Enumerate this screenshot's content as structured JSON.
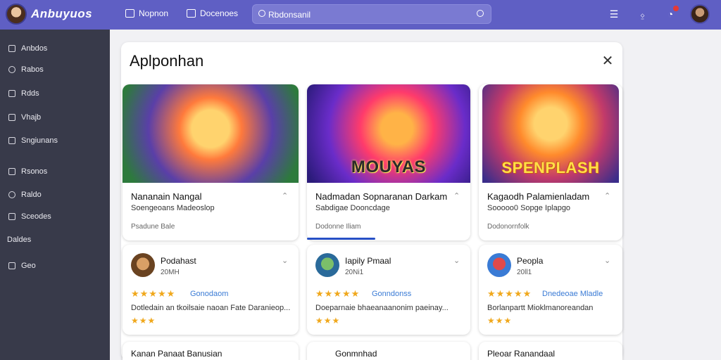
{
  "app": {
    "title": "Anbuyuos",
    "search_placeholder": "Rbdonsanil"
  },
  "topnav": [
    {
      "label": "Nopnon",
      "icon": "image-icon"
    },
    {
      "label": "Docenoes",
      "icon": "grid-icon"
    }
  ],
  "header_icons": [
    "checklist-icon",
    "bell-icon",
    "clock-icon",
    "user-avatar"
  ],
  "sidebar": {
    "items": [
      {
        "label": "Anbdos",
        "icon": "home-icon"
      },
      {
        "label": "Rabos",
        "icon": "circle-icon"
      },
      {
        "label": "Rdds",
        "icon": "bell-icon"
      },
      {
        "label": "Vhajb",
        "icon": "triangle-icon"
      },
      {
        "label": "Sngiunans",
        "icon": "document-icon"
      },
      {
        "label": "Rsonos",
        "icon": "pin-icon"
      },
      {
        "label": "Raldo",
        "icon": "search-icon"
      },
      {
        "label": "Sceodes",
        "icon": "list-icon"
      },
      {
        "label": "Daldes",
        "icon": ""
      },
      {
        "label": "Geo",
        "icon": "arrow-icon"
      }
    ]
  },
  "dialog": {
    "title": "Aplponhan"
  },
  "featured": [
    {
      "banner": "",
      "title": "Nananain Nangal",
      "subtitle": "Soengeoans Madeoslop",
      "meta": "Psadune Bale"
    },
    {
      "banner": "MOUYAS",
      "title": "Nadmadan Sopnaranan Darkam",
      "subtitle": "Sabdigae Dooncdage",
      "meta": "Dodonne Iliam"
    },
    {
      "banner": "SPENPLASH",
      "title": "Kagaodh Palamienladam",
      "subtitle": "Sooooo0 Sopge Iplapgo",
      "meta": "Dodonornfolk"
    }
  ],
  "reviews": [
    {
      "name": "Podahast",
      "subtitle": "20MH",
      "link": "Gonodaom",
      "text": "Dotledain an tkoilsaie naoan Fate Daranieop...",
      "stars": "★★★★★",
      "small_stars": "★★★"
    },
    {
      "name": "Iapily Pmaal",
      "subtitle": "20Ni1",
      "link": "Gonndonss",
      "text": "Doeparnaie bhaeanaanonim paeinay...",
      "stars": "★★★★★",
      "small_stars": "★★★"
    },
    {
      "name": "Peopla",
      "subtitle": "20ll1",
      "link": "Dnedeoae Mladle",
      "text": "Borlanpartt Mioklmanoreandan",
      "stars": "★★★★★",
      "small_stars": "★★★"
    }
  ],
  "bottom_cards": [
    {
      "title": "Kanan Panaat Banusian"
    },
    {
      "title": "Gonmnhad"
    },
    {
      "title": "Pleoar Ranandaal"
    }
  ]
}
